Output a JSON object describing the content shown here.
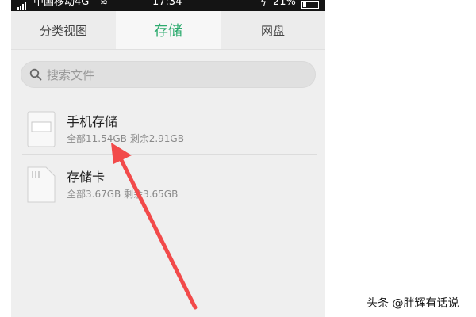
{
  "statusbar": {
    "carrier": "中国移动4G",
    "time": "17:34",
    "battery": "21%",
    "battery_level": 0.21
  },
  "tabs": [
    {
      "label": "分类视图",
      "active": false
    },
    {
      "label": "存储",
      "active": true
    },
    {
      "label": "网盘",
      "active": false
    }
  ],
  "search": {
    "placeholder": "搜索文件"
  },
  "storage": [
    {
      "title": "手机存储",
      "detail": "全部11.54GB 剩余2.91GB"
    },
    {
      "title": "存储卡",
      "detail": "全部3.67GB 剩余3.65GB"
    }
  ],
  "colors": {
    "accent": "#2eab6f",
    "arrow": "#f24a4a"
  },
  "watermark": "头条 @胖辉有话说"
}
